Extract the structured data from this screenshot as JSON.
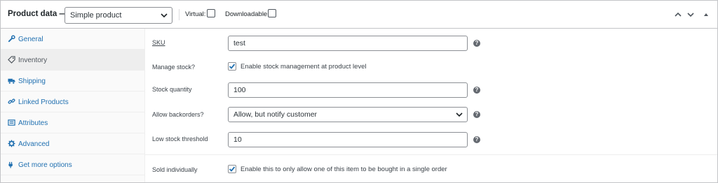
{
  "header": {
    "title": "Product data —",
    "product_type": {
      "selected": "Simple product"
    },
    "virtual_label": "Virtual:",
    "downloadable_label": "Downloadable:"
  },
  "tabs": [
    {
      "label": "General",
      "icon": "wrench-icon",
      "active": false
    },
    {
      "label": "Inventory",
      "icon": "tag-icon",
      "active": true
    },
    {
      "label": "Shipping",
      "icon": "truck-icon",
      "active": false
    },
    {
      "label": "Linked Products",
      "icon": "link-icon",
      "active": false
    },
    {
      "label": "Attributes",
      "icon": "list-icon",
      "active": false
    },
    {
      "label": "Advanced",
      "icon": "gear-icon",
      "active": false
    },
    {
      "label": "Get more options",
      "icon": "plugin-icon",
      "active": false
    }
  ],
  "fields": {
    "sku": {
      "label": "SKU",
      "value": "test"
    },
    "manage_stock": {
      "label": "Manage stock?",
      "checked": true,
      "description": "Enable stock management at product level"
    },
    "stock_qty": {
      "label": "Stock quantity",
      "value": "100"
    },
    "backorders": {
      "label": "Allow backorders?",
      "selected": "Allow, but notify customer"
    },
    "low_stock": {
      "label": "Low stock threshold",
      "value": "10"
    },
    "sold_individually": {
      "label": "Sold individually",
      "checked": true,
      "description": "Enable this to only allow one of this item to be bought in a single order"
    }
  },
  "colors": {
    "link": "#2271b1",
    "border": "#c3c4c7",
    "check": "#2271b1",
    "help": "#646970"
  }
}
